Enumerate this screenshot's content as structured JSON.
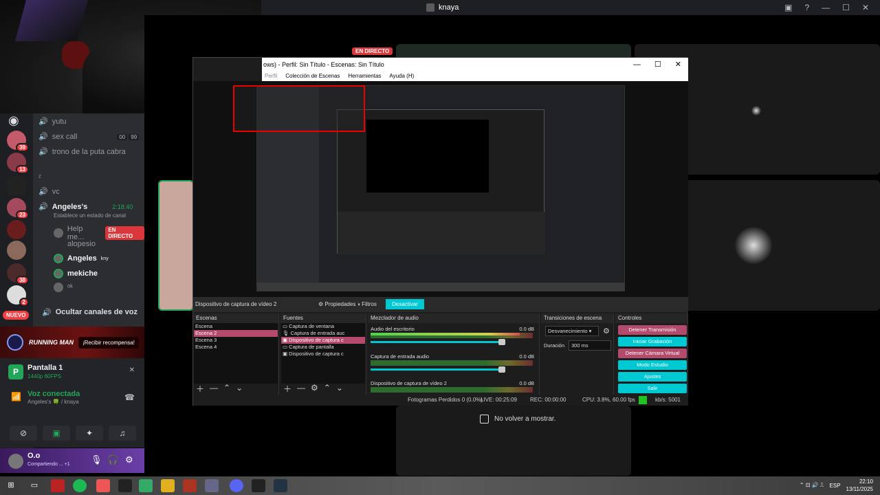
{
  "discord": {
    "window_title": "knaya",
    "nuevo_badge": "NUEVO",
    "badges": [
      "39",
      "13",
      "23",
      "38",
      "2"
    ],
    "channels": [
      {
        "name": "yutu"
      },
      {
        "name": "sex call",
        "counts": [
          "00",
          "99"
        ]
      },
      {
        "name": "trono de la puta cabra"
      },
      {
        "name": "ᶻ"
      },
      {
        "name": "vc"
      }
    ],
    "active_channel": {
      "user": "Angeles's",
      "time": "2:18:40",
      "status": "Establece un estado de canal"
    },
    "members": [
      {
        "name": "Help me...",
        "live": "EN DIRECTO"
      },
      {
        "name": "alopesio"
      },
      {
        "name": "Angeles",
        "tag": "kny"
      },
      {
        "name": "mekiche"
      },
      {
        "name": "ᵒᵏ"
      }
    ],
    "hide_voice_label": "Ocultar canales de voz",
    "promo": {
      "brand": "RUNNING MAN",
      "button": "¡Recibir recompensa!"
    },
    "screen_share": {
      "title": "Pantalla 1",
      "quality": "1440p 60FPS"
    },
    "voice": {
      "status": "Voz conectada",
      "location": "Angeles's 🍀 / knaya"
    },
    "user": {
      "name": "O.o",
      "status": "Compartiendo ... +1"
    },
    "live_badge": "EN DIRECTO",
    "dont_show": "No volver a mostrar."
  },
  "obs": {
    "title": "ows) - Perfil: Sin Título - Escenas: Sin Título",
    "menu": [
      "Perfil",
      "Colección de Escenas",
      "Herramientas",
      "Ayuda (H)"
    ],
    "source_bar": {
      "name": "Dispositivo de captura de vídeo 2",
      "properties": "Propiedades",
      "filters": "Filtros",
      "disable": "Desactivar"
    },
    "docks": {
      "scenes": "Escenas",
      "sources": "Fuentes",
      "mixer": "Mezclador de audio",
      "transitions": "Transiciones de escena",
      "controls": "Controles"
    },
    "scenes": [
      "Escena",
      "Escena 2",
      "Escena 3",
      "Escena 4"
    ],
    "sources": [
      "Captura de ventana",
      "Captura de entrada auc",
      "Dispositivo de captura c",
      "Captura de pantalla",
      "Dispositivo de captura c"
    ],
    "mixer": [
      {
        "name": "Audio del escritorio",
        "db": "0.0 dB",
        "level": 0.92
      },
      {
        "name": "Captura de entrada audio",
        "db": "0.0 dB",
        "level": 0.0
      },
      {
        "name": "Dispositivo de captura de vídeo 2",
        "db": "0.0 dB",
        "level": 0.0
      }
    ],
    "transition": {
      "type": "Desvanecimiento",
      "duration_label": "Duración",
      "duration": "300 ms"
    },
    "controls": [
      "Detener Transmisión",
      "Iniciar Grabación",
      "Detener Cámara Virtual",
      "Modo Estudio",
      "Ajustes",
      "Salir"
    ],
    "status": {
      "dropped": "Fotogramas Perdidos 0 (0.0%)",
      "live": "LIVE: 00:25:09",
      "rec": "REC: 00:00:00",
      "cpu": "CPU: 3.8%, 60.00 fps",
      "kbps": "kb/s: 5001"
    }
  },
  "taskbar": {
    "lang": "ESP",
    "time": "22:10",
    "date": "13/11/2025"
  }
}
